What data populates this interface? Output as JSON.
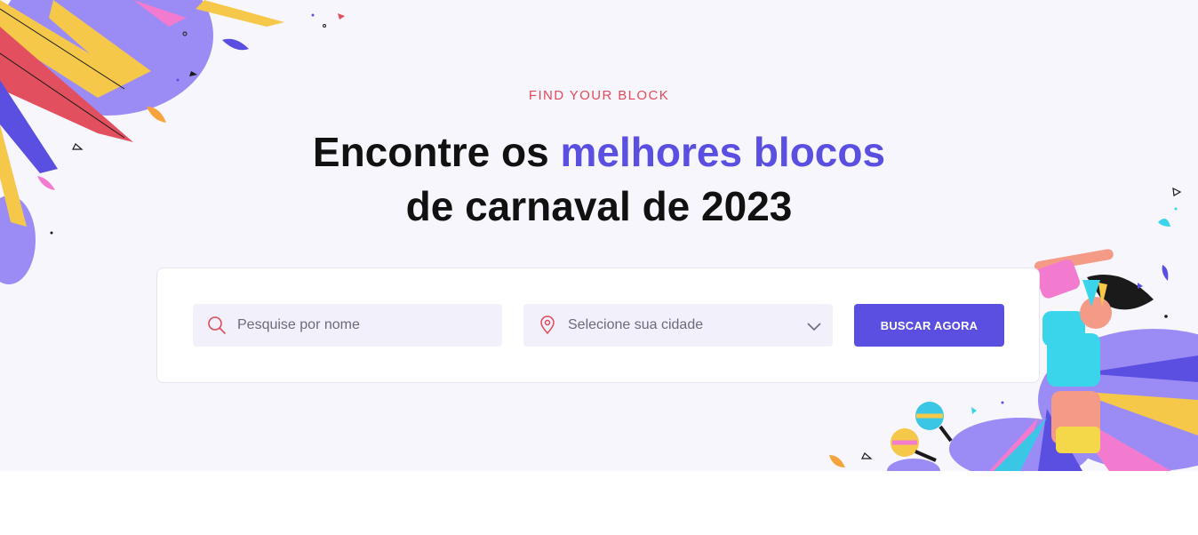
{
  "hero": {
    "eyebrow": "FIND YOUR BLOCK",
    "headline_part1": "Encontre os ",
    "headline_accent": "melhores blocos",
    "headline_part2": "de carnaval de 2023"
  },
  "search": {
    "name_placeholder": "Pesquise por nome",
    "city_selected": "Selecione sua cidade",
    "button_label": "BUSCAR AGORA",
    "icons": {
      "name": "search-icon",
      "city": "map-pin-icon",
      "dropdown": "chevron-down-icon"
    }
  },
  "colors": {
    "accent": "#5a4fe0",
    "eyebrow": "#e04b5a",
    "hero_bg": "#f7f6fd"
  }
}
